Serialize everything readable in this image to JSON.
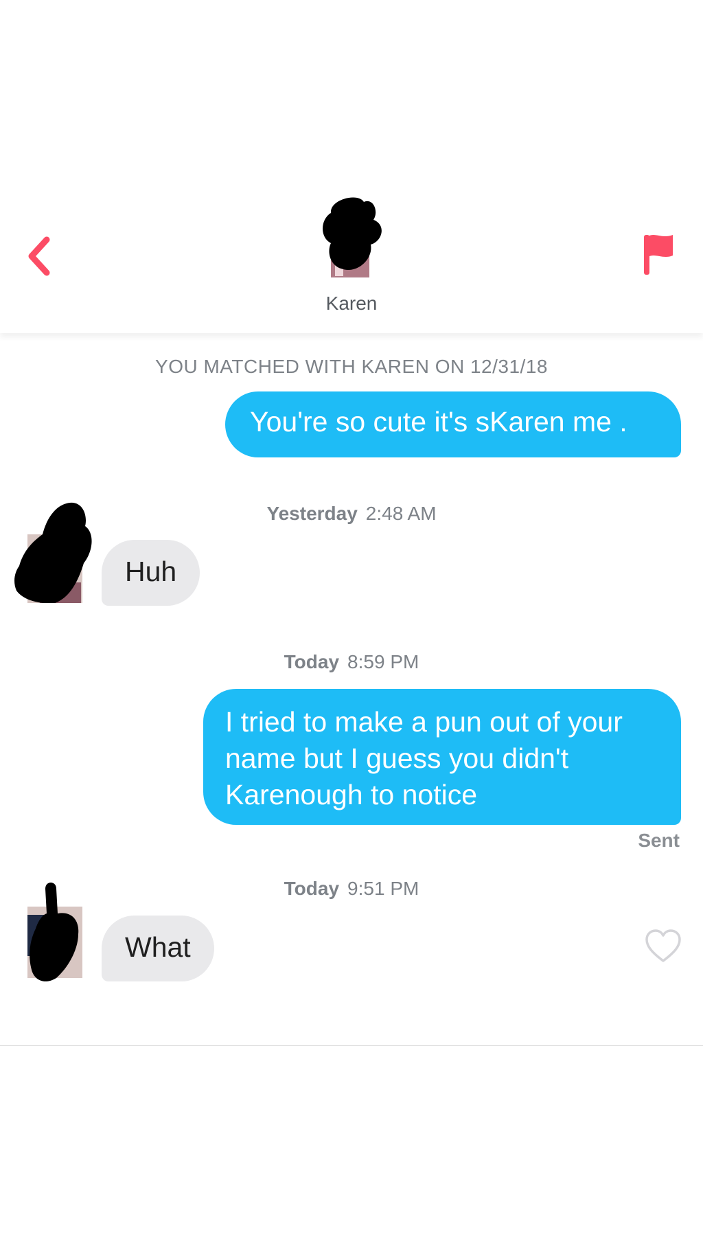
{
  "header": {
    "match_name": "Karen",
    "back_icon": "chevron-left-icon",
    "report_icon": "flag-icon",
    "accent_color": "#fc4c65"
  },
  "conversation": {
    "matched_text": "YOU MATCHED WITH KAREN ON 12/31/18",
    "messages": [
      {
        "direction": "outgoing",
        "text": "You're so cute it's sKaren me ."
      },
      {
        "timestamp_day": "Yesterday",
        "timestamp_time": "2:48 AM"
      },
      {
        "direction": "incoming",
        "text": "Huh"
      },
      {
        "timestamp_day": "Today",
        "timestamp_time": "8:59 PM"
      },
      {
        "direction": "outgoing",
        "text": "I tried to make a pun out of your name but I guess you didn't Karenough to notice",
        "status": "Sent"
      },
      {
        "timestamp_day": "Today",
        "timestamp_time": "9:51 PM"
      },
      {
        "direction": "incoming",
        "text": "What",
        "like_icon": "heart-outline-icon"
      }
    ],
    "colors": {
      "outgoing_bubble": "#1ebcf6",
      "incoming_bubble": "#e9e9eb",
      "meta_text": "#7d8288"
    }
  }
}
